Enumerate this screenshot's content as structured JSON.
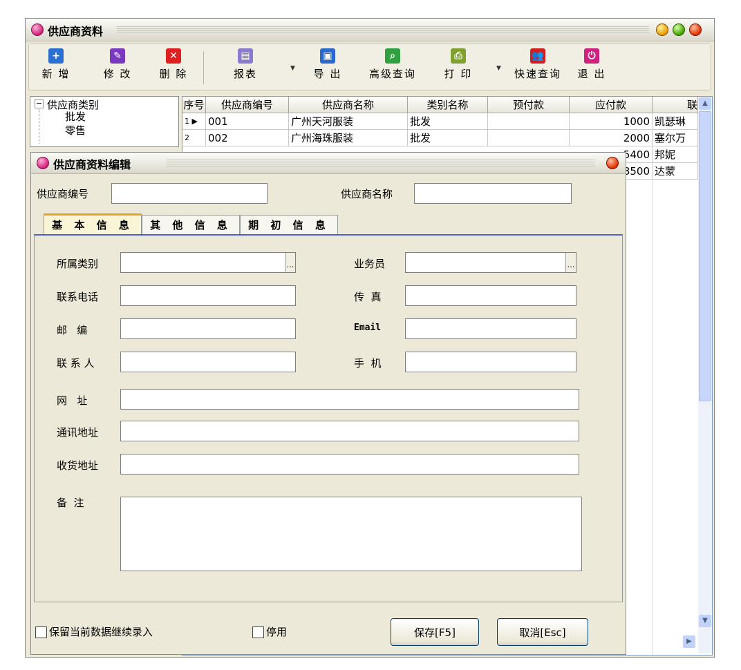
{
  "main_window": {
    "title": "供应商资料"
  },
  "toolbar": {
    "items": [
      {
        "label": "新 增",
        "icon": "plus-icon",
        "color": "#2a70d0"
      },
      {
        "label": "修 改",
        "icon": "edit-icon",
        "color": "#7a3ac0"
      },
      {
        "label": "删 除",
        "icon": "delete-icon",
        "color": "#e02020"
      },
      {
        "label": "报表",
        "icon": "report-icon",
        "color": "#8a7ad0"
      },
      {
        "label": "导 出",
        "icon": "export-icon",
        "color": "#2a6ad0"
      },
      {
        "label": "高级查询",
        "icon": "search-icon",
        "color": "#30a040"
      },
      {
        "label": "打 印",
        "icon": "print-icon",
        "color": "#80a030"
      },
      {
        "label": "快速查询",
        "icon": "users-icon",
        "color": "#d02020"
      },
      {
        "label": "退 出",
        "icon": "power-icon",
        "color": "#d02080"
      }
    ]
  },
  "tree": {
    "root": "供应商类别",
    "children": [
      "批发",
      "零售"
    ]
  },
  "grid": {
    "headers": [
      "序号",
      "供应商编号",
      "供应商名称",
      "类别名称",
      "预付款",
      "应付款",
      "联"
    ],
    "rows": [
      {
        "no": "1",
        "code": "001",
        "name": "广州天河服装",
        "category": "批发",
        "prepaid": "",
        "payable": "1000",
        "contact": "凯瑟琳"
      },
      {
        "no": "2",
        "code": "002",
        "name": "广州海珠服装",
        "category": "批发",
        "prepaid": "",
        "payable": "2000",
        "contact": "塞尔万"
      },
      {
        "no": "",
        "code": "",
        "name": "",
        "category": "",
        "prepaid": "",
        "payable": "5400",
        "contact": "邦妮"
      },
      {
        "no": "",
        "code": "",
        "name": "",
        "category": "",
        "prepaid": "",
        "payable": "3500",
        "contact": "达蒙"
      }
    ]
  },
  "dialog": {
    "title": "供应商资料编辑",
    "supplier_code_label": "供应商编号",
    "supplier_name_label": "供应商名称",
    "tabs": [
      "基 本 信 息",
      "其 他 信 息",
      "期 初 信 息"
    ],
    "fields": {
      "category": "所属类别",
      "salesman": "业务员",
      "phone": "联系电话",
      "fax": "传  真",
      "postcode": "邮   编",
      "email": "Email",
      "contact": "联 系 人",
      "mobile": "手  机",
      "website": "网   址",
      "address": "通讯地址",
      "delivery": "收货地址",
      "remark": "备  注"
    },
    "keep_data_label": "保留当前数据继续录入",
    "disable_label": "停用",
    "save_label": "保存[F5]",
    "cancel_label": "取消[Esc]"
  }
}
